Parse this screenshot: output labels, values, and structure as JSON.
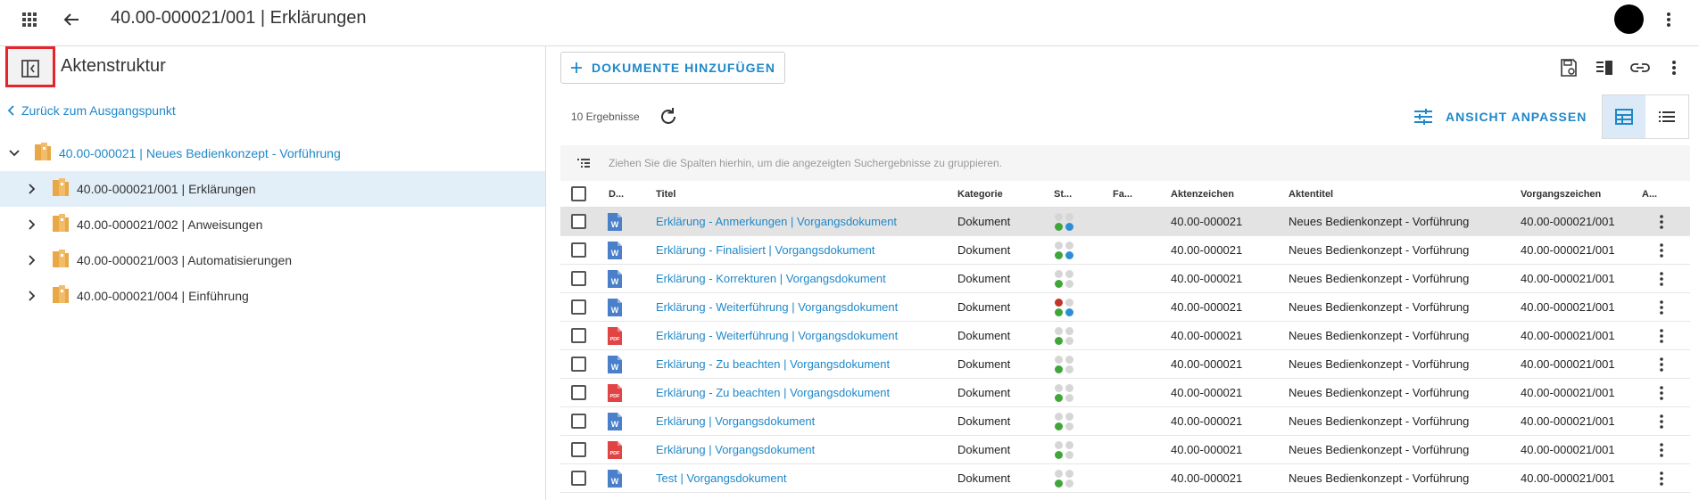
{
  "header": {
    "title": "40.00-000021/001 | Erklärungen"
  },
  "left": {
    "title": "Aktenstruktur",
    "back_link": "Zurück zum Ausgangspunkt",
    "root": "40.00-000021 | Neues Bedienkonzept - Vorführung",
    "items": [
      {
        "label": "40.00-000021/001 | Erklärungen",
        "selected": true
      },
      {
        "label": "40.00-000021/002 | Anweisungen",
        "selected": false
      },
      {
        "label": "40.00-000021/003 | Automatisierungen",
        "selected": false
      },
      {
        "label": "40.00-000021/004 | Einführung",
        "selected": false
      }
    ]
  },
  "toolbar": {
    "add_label": "DOKUMENTE HINZUFÜGEN",
    "results": "10 Ergebnisse",
    "customize_label": "ANSICHT ANPASSEN",
    "group_hint": "Ziehen Sie die Spalten hierhin, um die angezeigten Suchergebnisse zu gruppieren."
  },
  "columns": {
    "doc": "D...",
    "title": "Titel",
    "category": "Kategorie",
    "status": "St...",
    "fa": "Fa...",
    "aktenzeichen": "Aktenzeichen",
    "aktentitel": "Aktentitel",
    "vorgang": "Vorgangszeichen",
    "a": "A..."
  },
  "colors": {
    "accent": "#1e88c9",
    "selected_bg": "#e3eff8",
    "dot_green": "#3fa63a",
    "dot_blue": "#2c8fd6",
    "dot_red": "#c0342b",
    "dot_grey": "#d6d6d6",
    "word": "#4a7fc9",
    "pdf": "#e24444"
  },
  "rows": [
    {
      "type": "word",
      "title": "Erklärung - Anmerkungen | Vorgangsdokument",
      "category": "Dokument",
      "status": [
        "grey",
        "grey",
        "green",
        "blue"
      ],
      "aktenzeichen": "40.00-000021",
      "aktentitel": "Neues Bedienkonzept - Vorführung",
      "vorgang": "40.00-000021/001"
    },
    {
      "type": "word",
      "title": "Erklärung - Finalisiert | Vorgangsdokument",
      "category": "Dokument",
      "status": [
        "grey",
        "grey",
        "green",
        "blue"
      ],
      "aktenzeichen": "40.00-000021",
      "aktentitel": "Neues Bedienkonzept - Vorführung",
      "vorgang": "40.00-000021/001"
    },
    {
      "type": "word",
      "title": "Erklärung - Korrekturen | Vorgangsdokument",
      "category": "Dokument",
      "status": [
        "grey",
        "grey",
        "green",
        "grey"
      ],
      "aktenzeichen": "40.00-000021",
      "aktentitel": "Neues Bedienkonzept - Vorführung",
      "vorgang": "40.00-000021/001"
    },
    {
      "type": "word",
      "title": "Erklärung - Weiterführung | Vorgangsdokument",
      "category": "Dokument",
      "status": [
        "red",
        "grey",
        "green",
        "blue"
      ],
      "aktenzeichen": "40.00-000021",
      "aktentitel": "Neues Bedienkonzept - Vorführung",
      "vorgang": "40.00-000021/001"
    },
    {
      "type": "pdf",
      "title": "Erklärung - Weiterführung | Vorgangsdokument",
      "category": "Dokument",
      "status": [
        "grey",
        "grey",
        "green",
        "grey"
      ],
      "aktenzeichen": "40.00-000021",
      "aktentitel": "Neues Bedienkonzept - Vorführung",
      "vorgang": "40.00-000021/001"
    },
    {
      "type": "word",
      "title": "Erklärung - Zu beachten | Vorgangsdokument",
      "category": "Dokument",
      "status": [
        "grey",
        "grey",
        "green",
        "grey"
      ],
      "aktenzeichen": "40.00-000021",
      "aktentitel": "Neues Bedienkonzept - Vorführung",
      "vorgang": "40.00-000021/001"
    },
    {
      "type": "pdf",
      "title": "Erklärung - Zu beachten | Vorgangsdokument",
      "category": "Dokument",
      "status": [
        "grey",
        "grey",
        "green",
        "grey"
      ],
      "aktenzeichen": "40.00-000021",
      "aktentitel": "Neues Bedienkonzept - Vorführung",
      "vorgang": "40.00-000021/001"
    },
    {
      "type": "word",
      "title": "Erklärung | Vorgangsdokument",
      "category": "Dokument",
      "status": [
        "grey",
        "grey",
        "green",
        "grey"
      ],
      "aktenzeichen": "40.00-000021",
      "aktentitel": "Neues Bedienkonzept - Vorführung",
      "vorgang": "40.00-000021/001"
    },
    {
      "type": "pdf",
      "title": "Erklärung | Vorgangsdokument",
      "category": "Dokument",
      "status": [
        "grey",
        "grey",
        "green",
        "grey"
      ],
      "aktenzeichen": "40.00-000021",
      "aktentitel": "Neues Bedienkonzept - Vorführung",
      "vorgang": "40.00-000021/001"
    },
    {
      "type": "word",
      "title": "Test | Vorgangsdokument",
      "category": "Dokument",
      "status": [
        "grey",
        "grey",
        "green",
        "grey"
      ],
      "aktenzeichen": "40.00-000021",
      "aktentitel": "Neues Bedienkonzept - Vorführung",
      "vorgang": "40.00-000021/001"
    }
  ]
}
